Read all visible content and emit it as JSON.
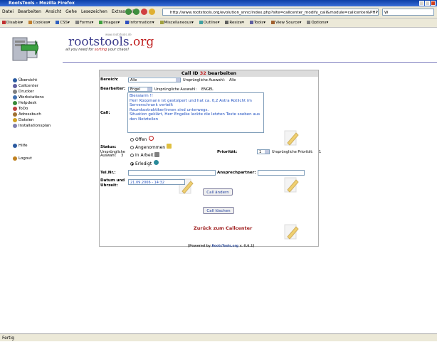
{
  "window": {
    "title": "RootsTools - Mozilla Firefox"
  },
  "menubar": {
    "items": [
      "Datei",
      "Bearbeiten",
      "Ansicht",
      "Gehe",
      "Lesezeichen",
      "Extras",
      "Hilfe"
    ],
    "url": "http://www.rootstools.org/evolution_snnc/index.php?site=callcenter_modify_call&module=callcenter&PHPSESSID=430428a6b",
    "search_value": "W"
  },
  "devbar": {
    "items": [
      "Disable▾",
      "Cookies▾",
      "CSS▾",
      "Forms▾",
      "Images▾",
      "Information▾",
      "Miscellaneous▾",
      "Outline▾",
      "Resize▾",
      "Tools▾",
      "View Source▾",
      "Options▾"
    ]
  },
  "logo": {
    "text_main": "rootstools",
    "text_org": ".org",
    "tagline_pre": "all you need for ",
    "tagline_red": "sorting",
    "tagline_post": " your chaos!",
    "top_small": "www.rootstools.de"
  },
  "sidebar": {
    "items": [
      "Übersicht",
      "Callcenter",
      "Drucker",
      "Workstations",
      "Helpdesk",
      "ToDo",
      "Adressbuch",
      "Dateien",
      "Installationsplan"
    ],
    "help": "Hilfe",
    "logout": "Logout"
  },
  "form": {
    "title_pre": "Call ID ",
    "title_num": "32",
    "title_post": " bearbeiten",
    "bereich_label": "Bereich:",
    "bereich_value": "Alle",
    "bereich_orig_label": "Ursprüngliche Auswahl:",
    "bereich_orig_value": "Alle",
    "bearbeiter_label": "Bearbeiter:",
    "bearbeiter_value": "Engel",
    "bearbeiter_orig_label": "Ursprüngliche Auswahl:",
    "bearbeiter_orig_value": "ENGEL",
    "call_label": "Call:",
    "call_lines": [
      "Bieraiarm !!",
      "Herr Koopmann ist gestolpert und hat ca. 0,2 Astra Rotlicht im Serverschrank verteilt",
      "Raumkostraktiker/innen sind unterwegs.",
      "Situation geklärt, Herr Engelke leckte die letzten Teste soeben aus den Netzteilen"
    ],
    "status_label": "Status:",
    "status_orig_label": "Ursprüngliche",
    "status_orig_label2": "Auswahl:",
    "status_orig_value": "3",
    "status_options": [
      "Offen",
      "Angenommen",
      "In Arbeit",
      "Erledigt"
    ],
    "status_selected": 3,
    "prio_label": "Priorität:",
    "prio_value": "1",
    "prio_orig_label": "Ursprüngliche Priorität:",
    "prio_orig_value": "1",
    "tel_label": "Tel.Nr.:",
    "tel_value": "",
    "ansprech_label": "Ansprechpartner:",
    "ansprech_value": "",
    "datum_label": "Datum und",
    "datum_label2": "Uhrzeit:",
    "datum_value": "21.09.2006 - 14:32",
    "btn_change": "Call ändern",
    "btn_delete": "Call löschen"
  },
  "back_link": "Zurück zum Callcenter",
  "powered": {
    "pre": "[Powered by ",
    "name": "RootsTools.org",
    "post": " v. 0.6.1]"
  },
  "status_text": "Fertig",
  "colors": {
    "accent": "#c02020",
    "link_blue": "#2050c0",
    "title_bar": "#0b3ea6"
  }
}
